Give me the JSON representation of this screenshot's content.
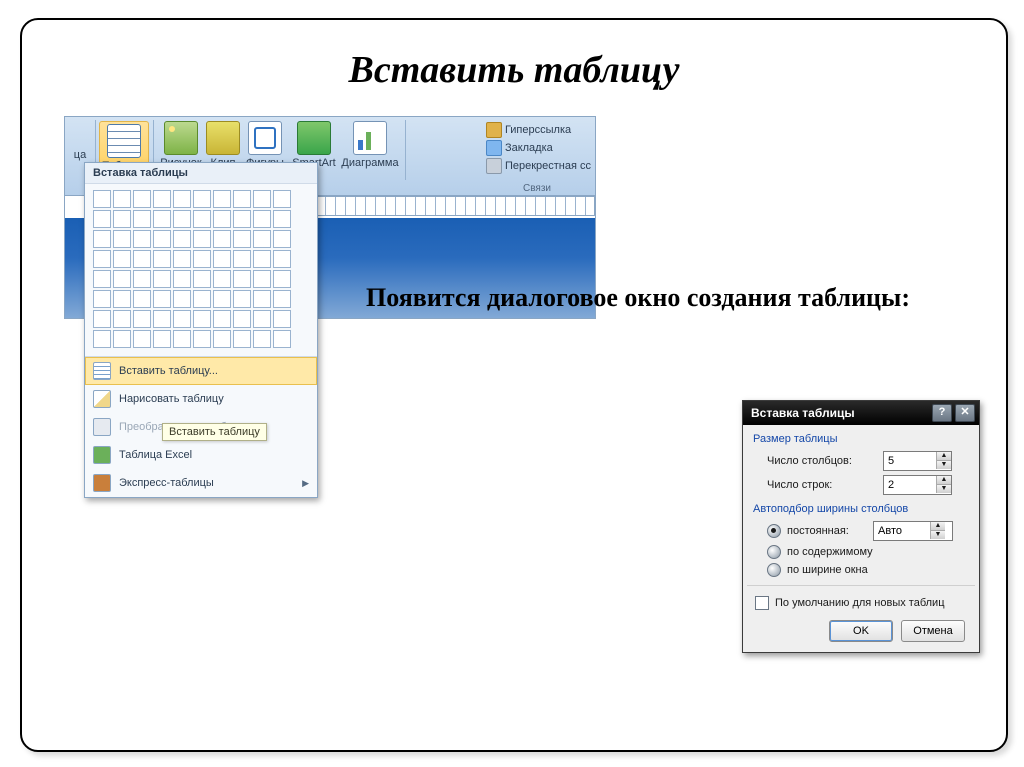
{
  "slide": {
    "title": "Вставить таблицу",
    "body_text": "Появится диалоговое окно создания таблицы:"
  },
  "ribbon": {
    "partial_label_left": "ца",
    "items": [
      {
        "label": "Таблица"
      },
      {
        "label": "Рисунок"
      },
      {
        "label": "Клип"
      },
      {
        "label": "Фигуры"
      },
      {
        "label": "SmartArt"
      },
      {
        "label": "Диаграмма"
      }
    ],
    "links": {
      "hyperlink": "Гиперссылка",
      "bookmark": "Закладка",
      "crossref": "Перекрестная сс"
    },
    "links_group": "Связи"
  },
  "dropdown": {
    "title": "Вставка таблицы",
    "grid_rows": 8,
    "grid_cols": 10,
    "items": {
      "insert": "Вставить таблицу...",
      "draw": "Нарисовать таблицу",
      "convert": "Преобразовать в таблицу",
      "excel": "Таблица Excel",
      "express": "Экспресс-таблицы"
    },
    "tooltip": "Вставить таблицу"
  },
  "dialog": {
    "title": "Вставка таблицы",
    "section_size": "Размер таблицы",
    "cols_label": "Число столбцов:",
    "cols_value": "5",
    "rows_label": "Число строк:",
    "rows_value": "2",
    "section_autofit": "Автоподбор ширины столбцов",
    "opt_fixed": "постоянная:",
    "fixed_value": "Авто",
    "opt_content": "по содержимому",
    "opt_window": "по ширине окна",
    "remember": "По умолчанию для новых таблиц",
    "ok": "OK",
    "cancel": "Отмена"
  }
}
